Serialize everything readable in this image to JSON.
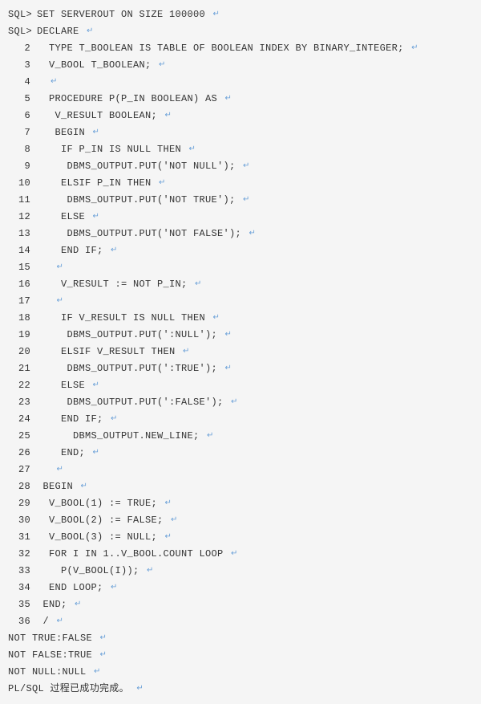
{
  "return_marker": "↵",
  "lines": [
    {
      "gutter": "SQL>",
      "code": "SET SERVEROUT ON SIZE 100000 "
    },
    {
      "gutter": "SQL>",
      "code": "DECLARE "
    },
    {
      "gutter": "2",
      "code": "  TYPE T_BOOLEAN IS TABLE OF BOOLEAN INDEX BY BINARY_INTEGER; "
    },
    {
      "gutter": "3",
      "code": "  V_BOOL T_BOOLEAN; "
    },
    {
      "gutter": "4",
      "code": "  "
    },
    {
      "gutter": "5",
      "code": "  PROCEDURE P(P_IN BOOLEAN) AS "
    },
    {
      "gutter": "6",
      "code": "   V_RESULT BOOLEAN; "
    },
    {
      "gutter": "7",
      "code": "   BEGIN "
    },
    {
      "gutter": "8",
      "code": "    IF P_IN IS NULL THEN "
    },
    {
      "gutter": "9",
      "code": "     DBMS_OUTPUT.PUT('NOT NULL'); "
    },
    {
      "gutter": "10",
      "code": "    ELSIF P_IN THEN "
    },
    {
      "gutter": "11",
      "code": "     DBMS_OUTPUT.PUT('NOT TRUE'); "
    },
    {
      "gutter": "12",
      "code": "    ELSE "
    },
    {
      "gutter": "13",
      "code": "     DBMS_OUTPUT.PUT('NOT FALSE'); "
    },
    {
      "gutter": "14",
      "code": "    END IF; "
    },
    {
      "gutter": "15",
      "code": "   "
    },
    {
      "gutter": "16",
      "code": "    V_RESULT := NOT P_IN; "
    },
    {
      "gutter": "17",
      "code": "   "
    },
    {
      "gutter": "18",
      "code": "    IF V_RESULT IS NULL THEN "
    },
    {
      "gutter": "19",
      "code": "     DBMS_OUTPUT.PUT(':NULL'); "
    },
    {
      "gutter": "20",
      "code": "    ELSIF V_RESULT THEN "
    },
    {
      "gutter": "21",
      "code": "     DBMS_OUTPUT.PUT(':TRUE'); "
    },
    {
      "gutter": "22",
      "code": "    ELSE "
    },
    {
      "gutter": "23",
      "code": "     DBMS_OUTPUT.PUT(':FALSE'); "
    },
    {
      "gutter": "24",
      "code": "    END IF; "
    },
    {
      "gutter": "25",
      "code": "      DBMS_OUTPUT.NEW_LINE; "
    },
    {
      "gutter": "26",
      "code": "    END; "
    },
    {
      "gutter": "27",
      "code": "   "
    },
    {
      "gutter": "28",
      "code": " BEGIN "
    },
    {
      "gutter": "29",
      "code": "  V_BOOL(1) := TRUE; "
    },
    {
      "gutter": "30",
      "code": "  V_BOOL(2) := FALSE; "
    },
    {
      "gutter": "31",
      "code": "  V_BOOL(3) := NULL; "
    },
    {
      "gutter": "32",
      "code": "  FOR I IN 1..V_BOOL.COUNT LOOP "
    },
    {
      "gutter": "33",
      "code": "    P(V_BOOL(I)); "
    },
    {
      "gutter": "34",
      "code": "  END LOOP; "
    },
    {
      "gutter": "35",
      "code": " END; "
    },
    {
      "gutter": "36",
      "code": " / "
    },
    {
      "gutter": "",
      "code": "NOT TRUE:FALSE "
    },
    {
      "gutter": "",
      "code": "NOT FALSE:TRUE "
    },
    {
      "gutter": "",
      "code": "NOT NULL:NULL "
    },
    {
      "gutter": "",
      "code": "PL/SQL 过程已成功完成。 "
    }
  ]
}
